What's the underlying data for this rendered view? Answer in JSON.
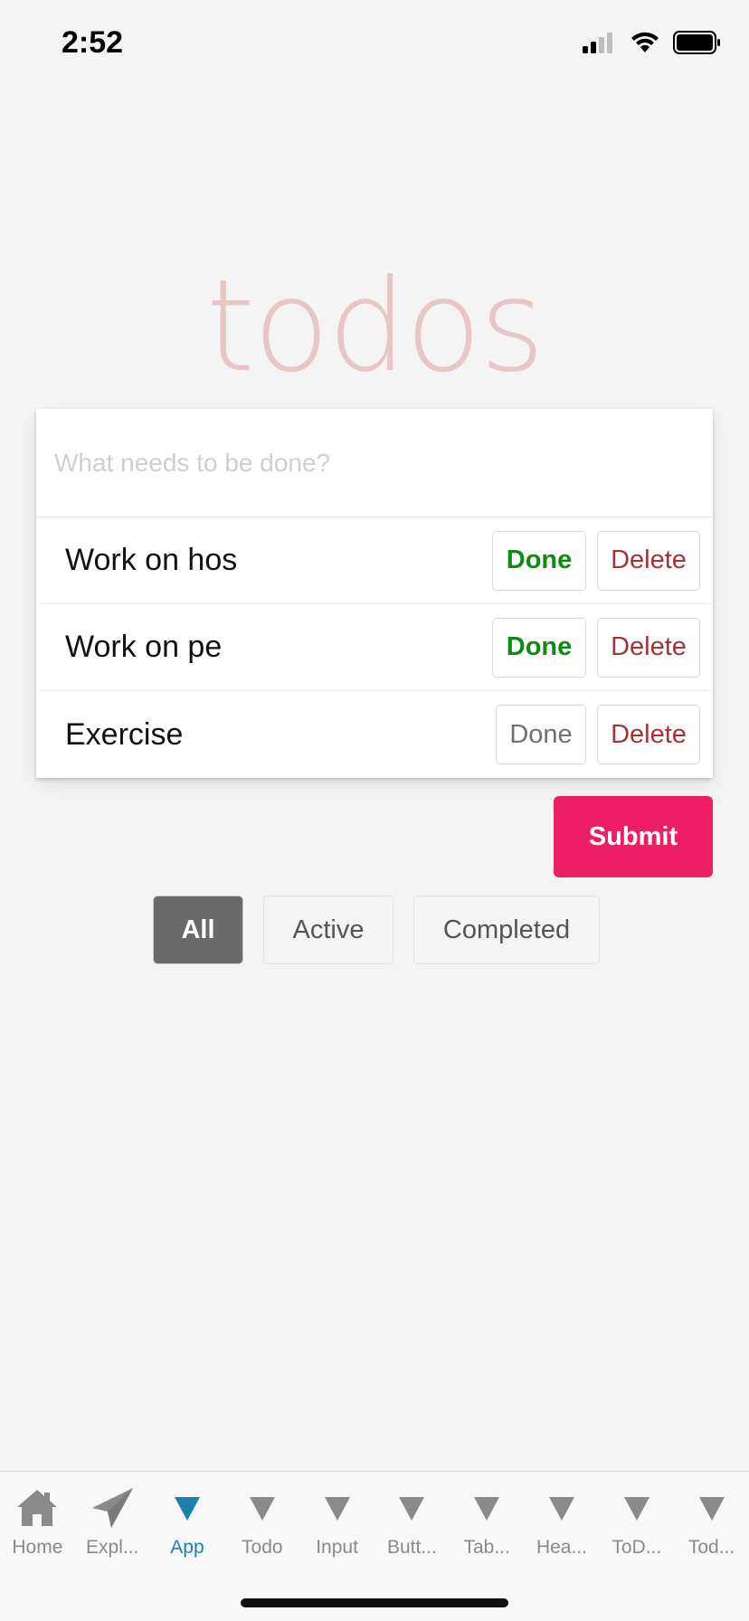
{
  "status_bar": {
    "time": "2:52"
  },
  "title": "todos",
  "new_todo": {
    "placeholder": "What needs to be done?",
    "value": ""
  },
  "todos": [
    {
      "text": "Work on hos",
      "done_label": "Done",
      "delete_label": "Delete",
      "done_style": "active"
    },
    {
      "text": "Work on pe",
      "done_label": "Done",
      "delete_label": "Delete",
      "done_style": "active"
    },
    {
      "text": "Exercise",
      "done_label": "Done",
      "delete_label": "Delete",
      "done_style": "plain"
    }
  ],
  "submit_label": "Submit",
  "filters": [
    {
      "label": "All",
      "selected": true
    },
    {
      "label": "Active",
      "selected": false
    },
    {
      "label": "Completed",
      "selected": false
    }
  ],
  "tab_bar": {
    "tabs": [
      {
        "label": "Home",
        "icon": "home-icon"
      },
      {
        "label": "Expl...",
        "icon": "paper-plane-icon"
      },
      {
        "label": "App",
        "icon": "triangle-icon",
        "selected": true
      },
      {
        "label": "Todo",
        "icon": "triangle-icon"
      },
      {
        "label": "Input",
        "icon": "triangle-icon"
      },
      {
        "label": "Butt...",
        "icon": "triangle-icon"
      },
      {
        "label": "Tab...",
        "icon": "triangle-icon"
      },
      {
        "label": "Hea...",
        "icon": "triangle-icon"
      },
      {
        "label": "ToD...",
        "icon": "triangle-icon"
      },
      {
        "label": "Tod...",
        "icon": "triangle-icon"
      }
    ]
  },
  "colors": {
    "accent": "#ec1f66",
    "done_green": "#118a11",
    "delete_red": "#a83232",
    "tab_selected": "#1a82a8",
    "title_pink": "#e8c6c6"
  }
}
